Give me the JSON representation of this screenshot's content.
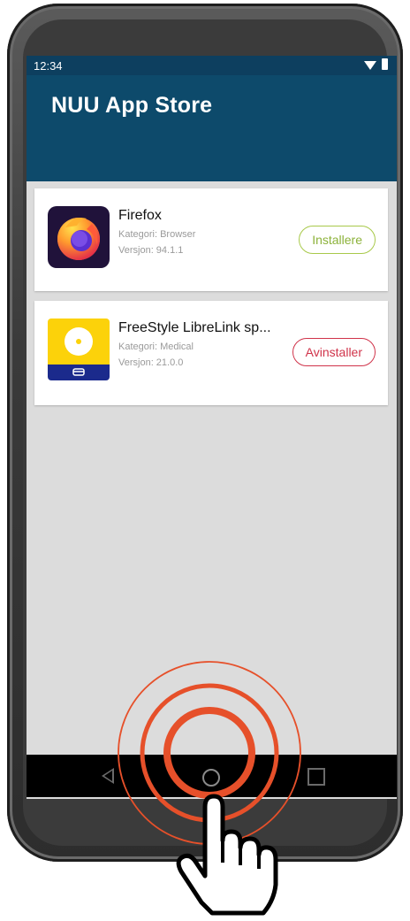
{
  "status_bar": {
    "time": "12:34",
    "icons": [
      "wifi-icon",
      "battery-icon"
    ]
  },
  "app_bar": {
    "title": "NUU App Store"
  },
  "apps": [
    {
      "name": "Firefox",
      "category": "Kategori: Browser",
      "version": "Versjon: 94.1.1",
      "action": "Installere",
      "icon": "firefox-icon"
    },
    {
      "name": "FreeStyle LibreLink sp...",
      "category": "Kategori: Medical",
      "version": "Versjon: 21.0.0",
      "action": "Avinstaller",
      "icon": "freestyle-librelink-icon"
    }
  ],
  "nav_bar": {
    "buttons": [
      "back-icon",
      "home-icon",
      "recent-apps-icon"
    ]
  },
  "overlay": {
    "gesture": "tap-hand-icon",
    "target": "home-button"
  },
  "colors": {
    "app_bar": "#0d4a6b",
    "status_bar": "#0d3f5f",
    "screen_background": "#dcdcdc",
    "install": "#8cb23a",
    "uninstall": "#d0334a",
    "tap_ring": "#e6502a"
  }
}
